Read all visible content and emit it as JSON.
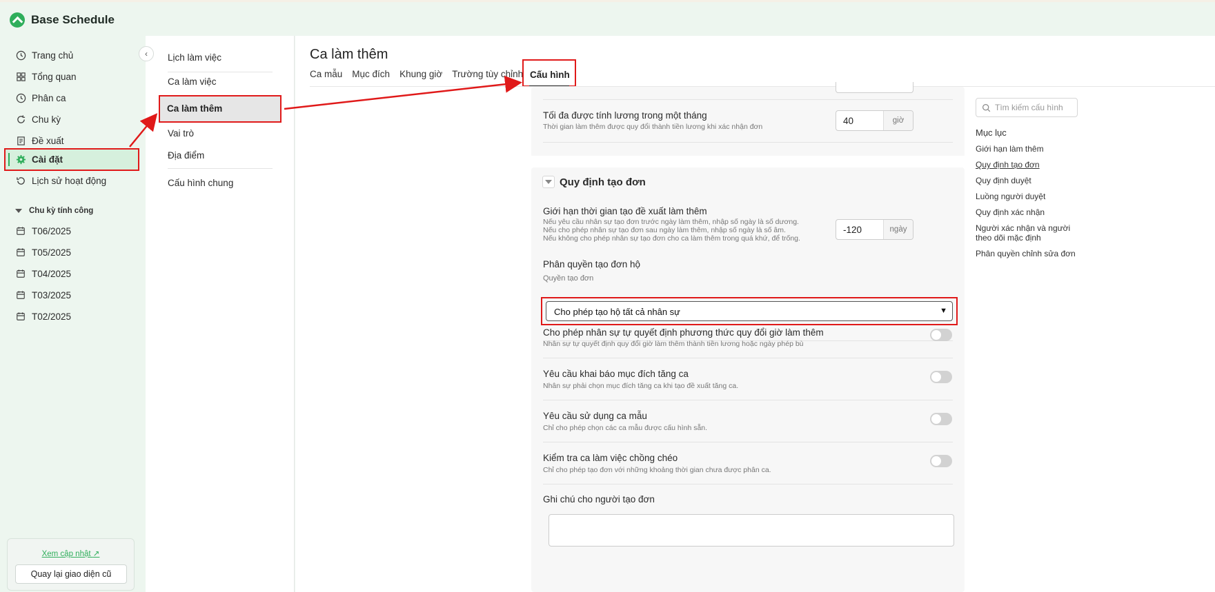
{
  "app": {
    "title": "Base Schedule"
  },
  "sidebar": {
    "items": [
      {
        "label": "Trang chủ",
        "icon": "clock-icon"
      },
      {
        "label": "Tổng quan",
        "icon": "grid-icon"
      },
      {
        "label": "Phân ca",
        "icon": "clock-icon"
      },
      {
        "label": "Chu kỳ",
        "icon": "refresh-icon"
      },
      {
        "label": "Đề xuất",
        "icon": "document-icon"
      },
      {
        "label": "Cài đặt",
        "icon": "gear-icon",
        "active": true
      },
      {
        "label": "Lịch sử hoạt động",
        "icon": "history-icon"
      }
    ],
    "section_title": "Chu kỳ tính công",
    "periods": [
      "T06/2025",
      "T05/2025",
      "T04/2025",
      "T03/2025",
      "T02/2025"
    ],
    "update_link": "Xem cập nhật",
    "back_button": "Quay lại giao diện cũ"
  },
  "subsidebar": {
    "items": [
      "Lịch làm việc",
      "Ca làm việc",
      "Ca làm thêm",
      "Vai trò",
      "Địa điểm",
      "Cấu hình chung"
    ],
    "active": "Ca làm thêm"
  },
  "main": {
    "title": "Ca làm thêm",
    "tabs": [
      "Ca mẫu",
      "Mục đích",
      "Khung giờ",
      "Trường tùy chỉnh",
      "Cấu hình"
    ],
    "active_tab": "Cấu hình",
    "max_salary": {
      "title": "Tối đa được tính lương trong một tháng",
      "desc": "Thời gian làm thêm được quy đổi thành tiền lương khi xác nhận đơn",
      "value": "40",
      "unit": "giờ"
    },
    "section": {
      "title": "Quy định tạo đơn",
      "time_limit": {
        "title": "Giới hạn thời gian tạo đề xuất làm thêm",
        "desc1": "Nếu yêu cầu nhân sự tạo đơn trước ngày làm thêm, nhập số ngày là số dương.",
        "desc2": "Nếu cho phép nhân sự tạo đơn sau ngày làm thêm, nhập số ngày là số âm.",
        "desc3": "Nếu không cho phép nhân sự tạo đơn cho ca làm thêm trong quá khứ, để trống.",
        "value": "-120",
        "unit": "ngày"
      },
      "proxy": {
        "title": "Phân quyền tạo đơn hộ",
        "field_label": "Quyền tạo đơn",
        "selected": "Cho phép tạo hộ tất cả nhân sự"
      },
      "toggles": [
        {
          "title": "Cho phép nhân sự tự quyết định phương thức quy đổi giờ làm thêm",
          "desc": "Nhân sự tự quyết định quy đổi giờ làm thêm thành tiền lương hoặc ngày phép bù",
          "on": false
        },
        {
          "title": "Yêu cầu khai báo mục đích tăng ca",
          "desc": "Nhân sự phải chọn mục đích tăng ca khi tạo đề xuất tăng ca.",
          "on": false
        },
        {
          "title": "Yêu cầu sử dụng ca mẫu",
          "desc": "Chỉ cho phép chọn các ca mẫu được cấu hình sẵn.",
          "on": false
        },
        {
          "title": "Kiểm tra ca làm việc chồng chéo",
          "desc": "Chỉ cho phép tạo đơn với những khoảng thời gian chưa được phân ca.",
          "on": false
        }
      ],
      "note_title": "Ghi chú cho người tạo đơn"
    }
  },
  "toc": {
    "search_placeholder": "Tìm kiếm cấu hình",
    "title": "Mục lục",
    "items": [
      "Giới hạn làm thêm",
      "Quy định tạo đơn",
      "Quy định duyệt",
      "Luồng người duyệt",
      "Quy định xác nhận",
      "Người xác nhận và người theo dõi mặc định",
      "Phân quyền chỉnh sửa đơn"
    ],
    "active": "Quy định tạo đơn"
  },
  "colors": {
    "accent": "#2fae5b",
    "highlight": "#e01919",
    "sidebar_bg": "#edf6ef"
  }
}
